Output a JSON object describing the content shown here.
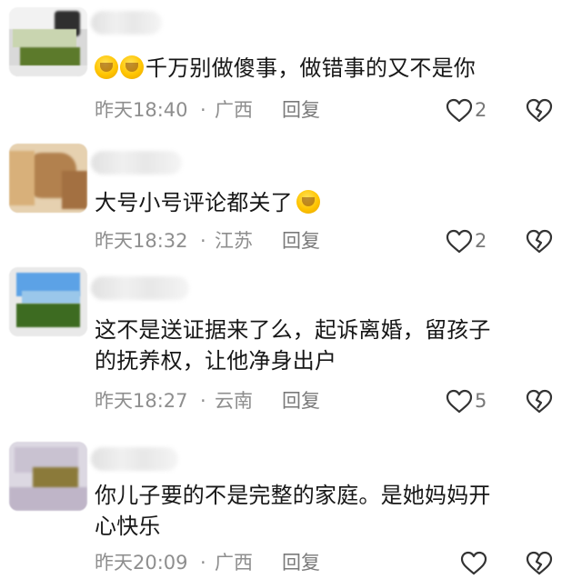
{
  "comments": [
    {
      "text": "千万别做傻事，做错事的又不是你",
      "time": "昨天18:40",
      "dot": "·",
      "region": "广西",
      "reply": "回复",
      "likes": "2"
    },
    {
      "text": "大号小号评论都关了",
      "time": "昨天18:32",
      "dot": "·",
      "region": "江苏",
      "reply": "回复",
      "likes": "2"
    },
    {
      "text_line1": "这不是送证据来了么，起诉离婚，留孩子",
      "text_line2": "的抚养权，让他净身出户",
      "time": "昨天18:27",
      "dot": "·",
      "region": "云南",
      "reply": "回复",
      "likes": "5"
    },
    {
      "text_line1": "你儿子要的不是完整的家庭。是她妈妈开",
      "text_line2": "心快乐",
      "time": "昨天20:09",
      "dot": "·",
      "region": "广西",
      "reply": "回复",
      "likes": ""
    }
  ],
  "icons": {
    "like": "heart-outline-icon",
    "dislike": "broken-heart-icon",
    "emoji_laugh": "laughing-crying-emoji-icon",
    "emoji_shy": "blushing-emoji-icon"
  },
  "colors": {
    "text": "#171717",
    "meta": "#8e8e8e",
    "icon_stroke": "#333333"
  }
}
